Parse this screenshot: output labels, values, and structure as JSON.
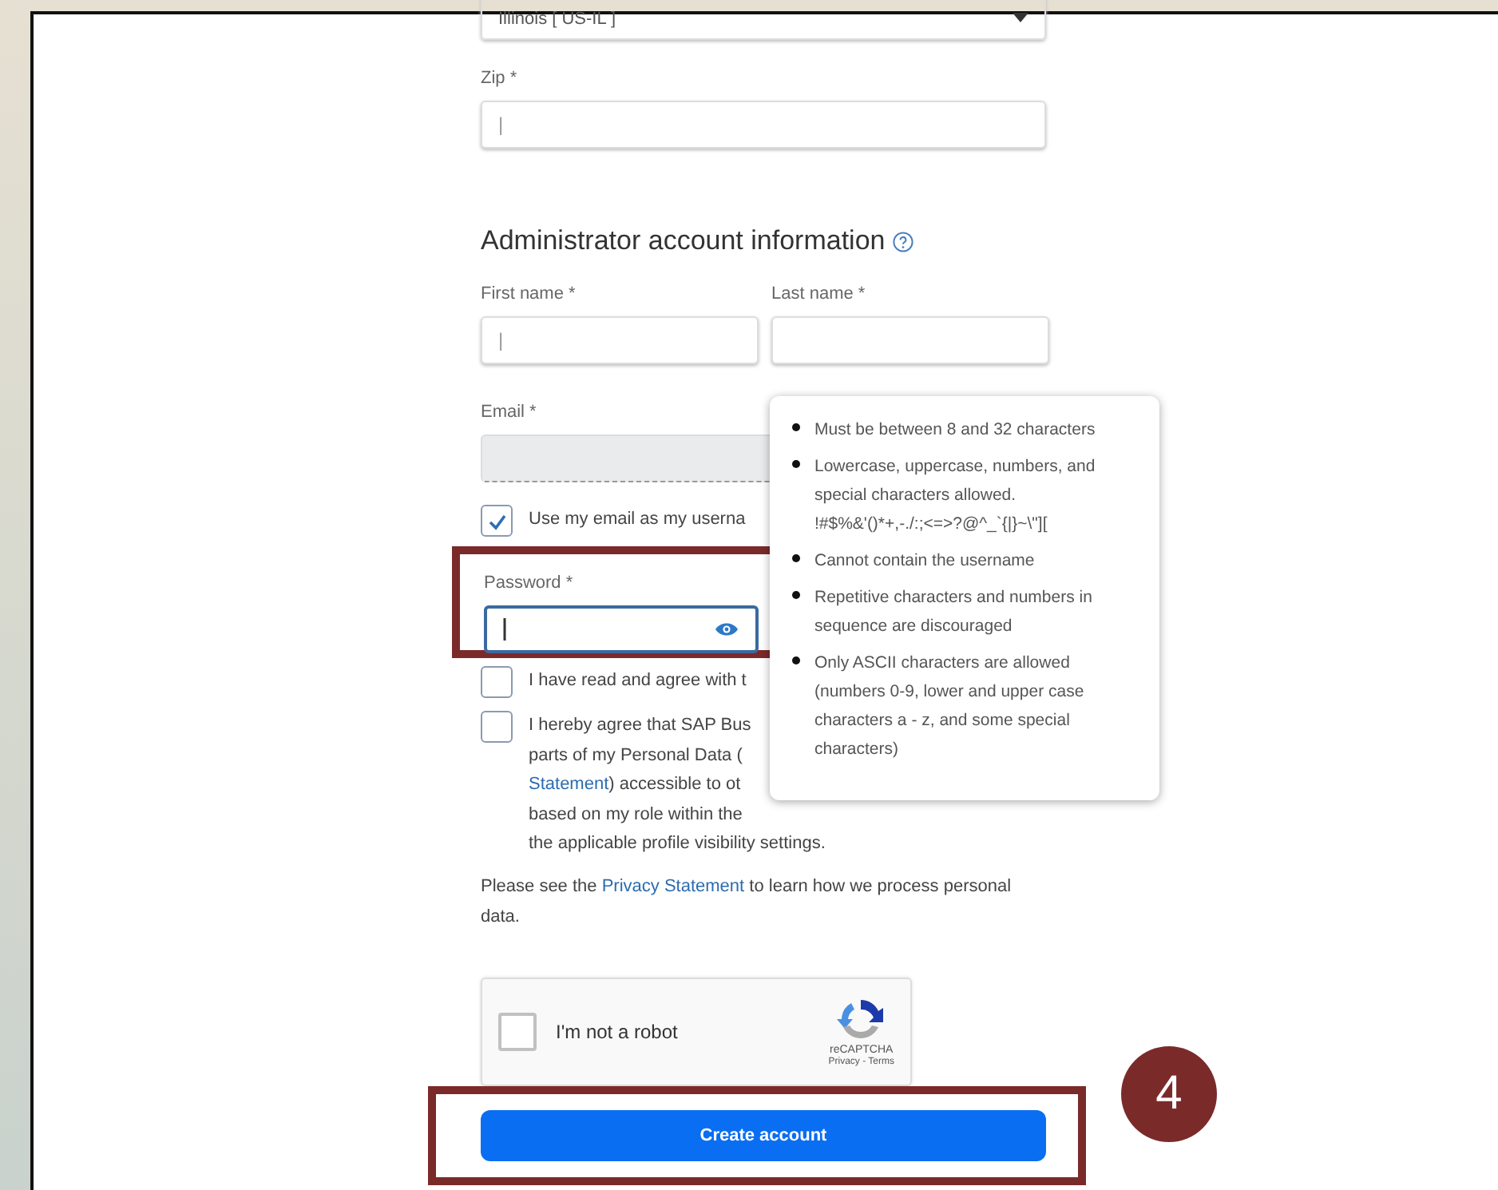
{
  "state_select": {
    "value": "Illinois [ US-IL ]"
  },
  "zip": {
    "label": "Zip *",
    "value": "|"
  },
  "section_title": "Administrator account information",
  "name_fields": [
    {
      "label": "First name *",
      "value": "|"
    },
    {
      "label": "Last name *"
    }
  ],
  "email": {
    "label": "Email *",
    "disabled": true
  },
  "username_checkbox": {
    "label": "Use my email as my userna",
    "checked": true
  },
  "password": {
    "label": "Password *",
    "focused": true
  },
  "agreements": [
    {
      "checked": false,
      "lines": [
        [
          {
            "text": "I have read and agree with t"
          }
        ]
      ]
    },
    {
      "checked": false,
      "lines": [
        [
          {
            "text": "I hereby agree that SAP Bus"
          }
        ],
        [
          {
            "text": "parts of my Personal Data ("
          }
        ],
        [
          {
            "link": "Statement"
          },
          {
            "text": ") accessible to ot"
          }
        ],
        [
          {
            "text": "based on my role within the"
          }
        ],
        [
          {
            "text": "the applicable profile visibility settings."
          }
        ]
      ]
    }
  ],
  "privacy_note": [
    {
      "text": "Please see the "
    },
    {
      "link": "Privacy Statement"
    },
    {
      "text": " to learn how we process personal data."
    }
  ],
  "captcha": {
    "label": "I'm not a robot",
    "checked": false,
    "brand": "reCAPTCHA",
    "links": "Privacy - Terms"
  },
  "submit_button": "Create account",
  "step_badge": "4",
  "password_tooltip": [
    {
      "text": "Must be between 8 and 32 characters"
    },
    {
      "text": "Lowercase, uppercase, numbers, and special characters allowed.",
      "detail": "!#$%&'()*+,-./:;<=>?@^_`{|}~\\\"]["
    },
    {
      "text": "Cannot contain the username"
    },
    {
      "text": "Repetitive characters and numbers in sequence are discouraged"
    },
    {
      "text": "Only ASCII characters are allowed (numbers 0-9, lower and upper case characters a - z, and some special characters)"
    }
  ]
}
